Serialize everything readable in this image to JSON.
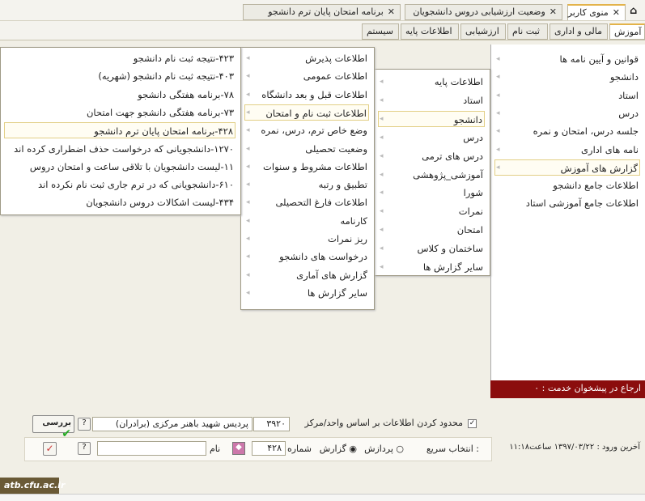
{
  "tabs": [
    "منوی کاربر",
    "وضعیت ارزشیابی دروس دانشجویان",
    "برنامه امتحان پایان ترم دانشجو"
  ],
  "menu_tabs": [
    "آموزش",
    "مالی و اداری",
    "ثبت نام",
    "ارزشیابی",
    "اطلاعات پایه",
    "سیستم"
  ],
  "menu1": [
    "قوانین و آیین نامه ها",
    "دانشجو",
    "استاد",
    "درس",
    "جلسه درس، امتحان و نمره",
    "نامه های اداری",
    "گزارش های آموزش",
    "اطلاعات جامع دانشجو",
    "اطلاعات جامع آموزشی استاد"
  ],
  "menu2": [
    "اطلاعات پایه",
    "استاد",
    "دانشجو",
    "درس",
    "درس های ترمی",
    "آموزشی_پژوهشی",
    "شورا",
    "نمرات",
    "امتحان",
    "ساختمان و کلاس",
    "سایر گزارش ها"
  ],
  "menu3": [
    "اطلاعات پذیرش",
    "اطلاعات عمومی",
    "اطلاعات قبل و بعد دانشگاه",
    "اطلاعات ثبت نام و امتحان",
    "وضع خاص ترم، درس، نمره",
    "وضعیت تحصیلی",
    "اطلاعات مشروط و سنوات",
    "تطبیق و رتبه",
    "اطلاعات فارغ التحصیلی",
    "کارنامه",
    "ریز نمرات",
    "درخواست های دانشجو",
    "گزارش های آماری",
    "سایر گزارش ها"
  ],
  "menu4": [
    "۴۲۳-نتیجه ثبت نام دانشجو",
    "۴۰۳-نتیجه ثبت نام دانشجو (شهریه)",
    "۷۸-برنامه هفتگی دانشجو",
    "۷۳-برنامه هفتگی دانشجو جهت امتحان",
    "۴۲۸-برنامه امتحان پایان ترم دانشجو",
    "۱۲۷۰-دانشجویانی که درخواست حذف اضطراری کرده اند",
    "۱۱-لیست دانشجویان با تلاقی ساعت و امتحان دروس",
    "۶۱۰-دانشجویانی که در ترم جاری ثبت نام نکرده اند",
    "۴۳۴-لیست اشکالات دروس دانشجویان"
  ],
  "referral": "ارجاع در پیشخوان خدمت : ۰",
  "filter": {
    "label": "محدود کردن اطلاعات بر اساس واحد/مرکز",
    "code": "۳۹۲۰",
    "center": "پردیس شهید باهنر مرکزی (برادران)",
    "check_label": "بررسی"
  },
  "quick": {
    "label": "انتخاب سریع :",
    "processing": "پردازش",
    "report": "گزارش",
    "number_label": "شماره",
    "number": "۴۲۸",
    "name_label": "نام",
    "name": ""
  },
  "last_login": "آخرین ورود : ۱۳۹۷/۰۳/۲۲ ساعت۱۱:۱۸",
  "footer_logo": "atb.cfu.ac.ir"
}
